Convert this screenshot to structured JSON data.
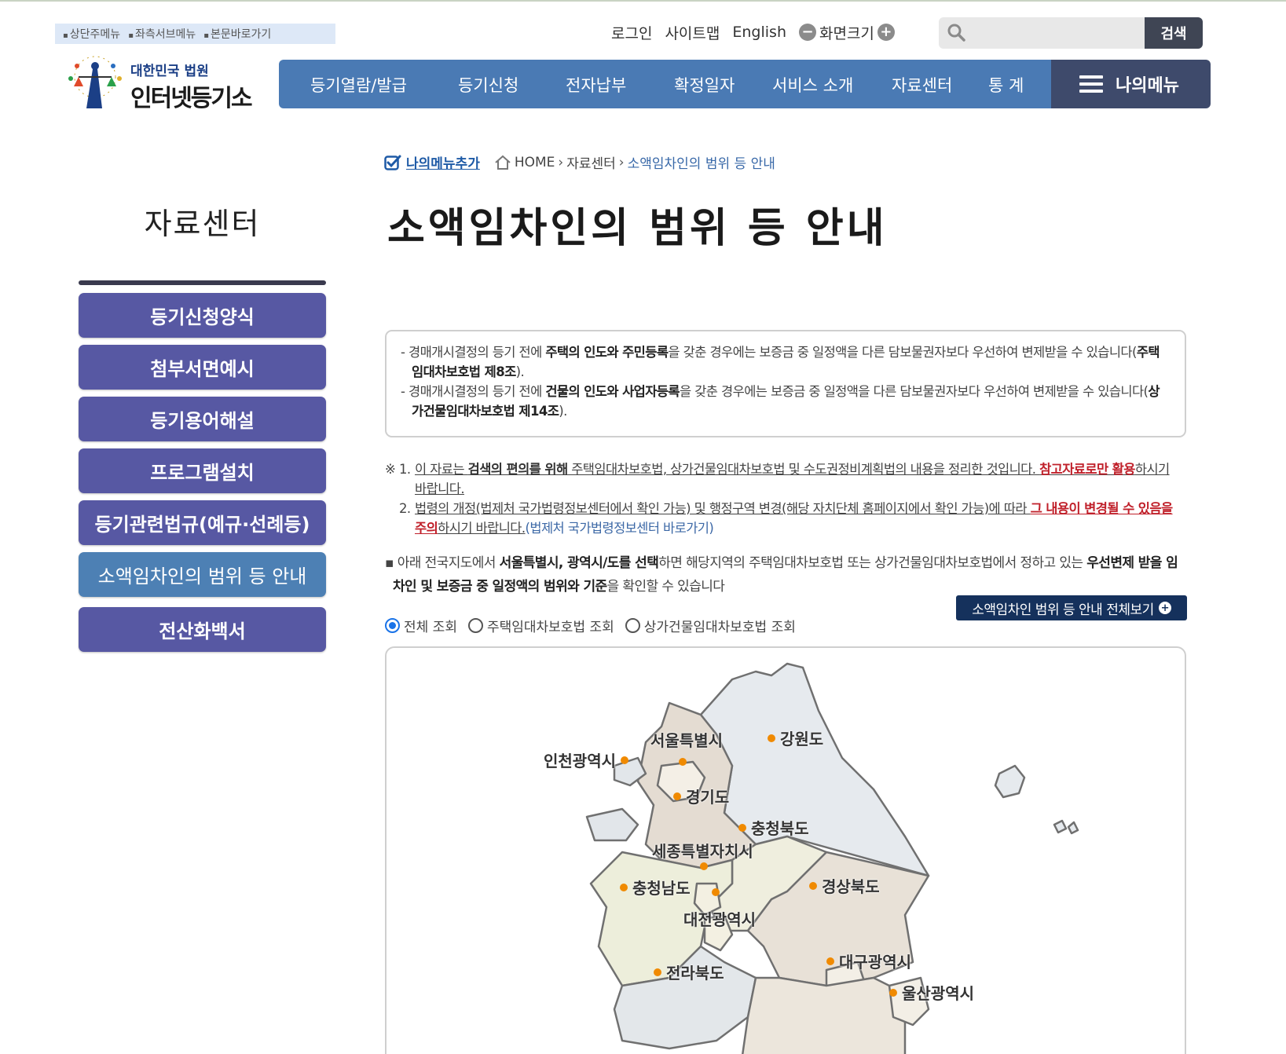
{
  "skip_links": [
    "상단주메뉴",
    "좌측서브메뉴",
    "본문바로가기"
  ],
  "logo": {
    "line1": "대한민국 법원",
    "line2": "인터넷등기소"
  },
  "util": {
    "login": "로그인",
    "sitemap": "사이트맵",
    "english": "English",
    "zoom": "화면크기",
    "zoom_minus": "−",
    "zoom_plus": "+"
  },
  "search": {
    "placeholder": "",
    "button": "검색"
  },
  "gnb": [
    "등기열람/발급",
    "등기신청",
    "전자납부",
    "확정일자",
    "서비스 소개",
    "자료센터",
    "통 계"
  ],
  "mymenu": "나의메뉴",
  "sidebar": {
    "title": "자료센터",
    "items": [
      "등기신청양식",
      "첨부서면예시",
      "등기용어해설",
      "프로그램설치",
      "등기관련법규(예규·선례등)",
      "소액임차인의 범위 등 안내",
      "전산화백서"
    ],
    "active_index": 5
  },
  "breadcrumb": {
    "add": "나의메뉴추가",
    "home": "HOME",
    "level1": "자료센터",
    "current": "소액임차인의 범위 등 안내"
  },
  "page_title": "소액임차인의 범위 등 안내",
  "notice": {
    "p1_a": "- 경매개시결정의 등기 전에 ",
    "p1_b": "주택의 인도와 주민등록",
    "p1_c": "을 갖춘 경우에는 보증금 중 일정액을 다른 담보물권자보다 우선하여 변제받을 수 있습니다(",
    "p1_d": "주택임대차보호법 제8조",
    "p1_e": ").",
    "p2_a": "- 경매개시결정의 등기 전에 ",
    "p2_b": "건물의 인도와 사업자등록",
    "p2_c": "을 갖춘 경우에는 보증금 중 일정액을 다른 담보물권자보다 우선하여 변제받을 수 있습니다(",
    "p2_d": "상가건물임대차보호법 제14조",
    "p2_e": ")."
  },
  "warn": {
    "mark": "※",
    "n1": "1.",
    "w1_a": "이 자료는 ",
    "w1_b": "검색의 편의를 위해",
    "w1_c": " 주택임대차보호법, 상가건물임대차보호법 및 수도권정비계획법의 내용을 정리한 것입니다. ",
    "w1_d": "참고자료로만 활용",
    "w1_e": "하시기 바랍니다.",
    "n2": "2.",
    "w2_a": "법령의 개정(법제처 국가법령정보센터에서 확인 가능) 및 행정구역 변경(해당 자치단체 홈페이지에서 확인 가능)에 따라 ",
    "w2_b": "그 내용이 변경될 수 있음을 주의",
    "w2_c": "하시기 바랍니다.",
    "w2_d": "(법제처 국가법령정보센터 바로가기)"
  },
  "desc": {
    "a": "▪ 아래 전국지도에서 ",
    "b": "서울특별시, 광역시/도를 선택",
    "c": "하면 해당지역의 주택임대차보호법 또는 상가건물임대차보호법에서 정하고 있는 ",
    "d": "우선변제 받을 임차인 및 보증금 중 일정액의 범위와 기준",
    "e": "을 확인할 수 있습니다"
  },
  "full_button": "소액임차인 범위 등 안내 전체보기",
  "radios": [
    {
      "label": "전체 조회",
      "checked": true
    },
    {
      "label": "주택임대차보호법 조회",
      "checked": false
    },
    {
      "label": "상가건물임대차보호법 조회",
      "checked": false
    }
  ],
  "regions": [
    "서울특별시",
    "인천광역시",
    "강원도",
    "경기도",
    "충청북도",
    "세종특별자치시",
    "충청남도",
    "경상북도",
    "대전광역시",
    "대구광역시",
    "전라북도",
    "울산광역시"
  ],
  "colors": {
    "gnb": "#4a7ab4",
    "mymenu": "#3e4a6b",
    "side_item": "#5758a3",
    "side_active": "#4d80b4",
    "warn_red": "#c0202a",
    "button_navy": "#15315c",
    "marker": "#f08a00"
  }
}
